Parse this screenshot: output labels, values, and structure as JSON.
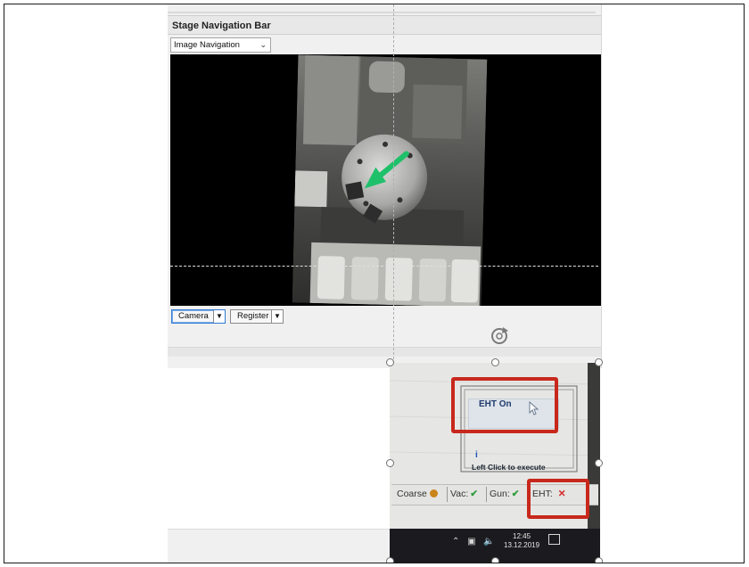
{
  "panel": {
    "title": "Stage Navigation Bar",
    "navigation_select": "Image Navigation",
    "camera_button": "Camera",
    "register_button": "Register"
  },
  "inset": {
    "eht_menu_item": "EHT On",
    "hint": "Left Click to execute",
    "status": {
      "coarse": "Coarse",
      "vac": "Vac:",
      "gun": "Gun:",
      "eht": "EHT:"
    },
    "taskbar": {
      "time": "12:45",
      "date": "13.12.2019"
    }
  },
  "icons": [
    "chevron-down-icon",
    "dropdown-arrow-icon",
    "green-arrow-icon",
    "mouse-cursor-icon",
    "info-icon",
    "check-icon",
    "x-icon",
    "rotate-icon"
  ],
  "colors": {
    "highlight_box": "#c8281c",
    "ok_check": "#2e9b3a",
    "error_x": "#d42b2b",
    "arrow": "#1fc06a"
  }
}
